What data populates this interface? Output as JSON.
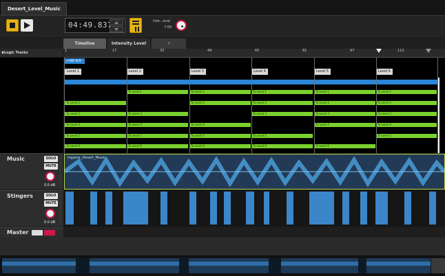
{
  "document_tab": "Desert_Level_Music",
  "transport": {
    "stop_icon": "stop-icon",
    "play_icon": "play-icon",
    "timecode": "04:49.837",
    "tempo_label": "Inte...eval",
    "tempo_value": "7.00"
  },
  "view_tabs": [
    "Timeline",
    "Intensity Level",
    "+"
  ],
  "ruler": {
    "ticks": [
      "1",
      "17",
      "33",
      "49",
      "65",
      "81",
      "97",
      "113"
    ]
  },
  "logic_tracks_label": "Logic Tracks",
  "tempo_marker": "♩=88 4/4",
  "levels": [
    "Level 1",
    "Level 2",
    "Level 3",
    "Level 4",
    "Level 5",
    "Level 6"
  ],
  "transitions": [
    "To Level 1",
    "To Level 2",
    "To Level 3",
    "To Level 4",
    "To Level 5",
    "To Level 6"
  ],
  "tracks": [
    {
      "name": "Music",
      "solo": "SOLO",
      "mute": "MUTE",
      "volume": "0.0 dB",
      "clip_label": "Ingame_Desert_Music"
    },
    {
      "name": "Stingers",
      "solo": "SOLO",
      "mute": "MUTE",
      "volume": "0.0 dB"
    },
    {
      "name": "Master"
    }
  ],
  "colors": {
    "accent": "#e7b416",
    "green": "#7bd12d",
    "blue": "#2a86d8",
    "knob_ring": "#d01848"
  }
}
